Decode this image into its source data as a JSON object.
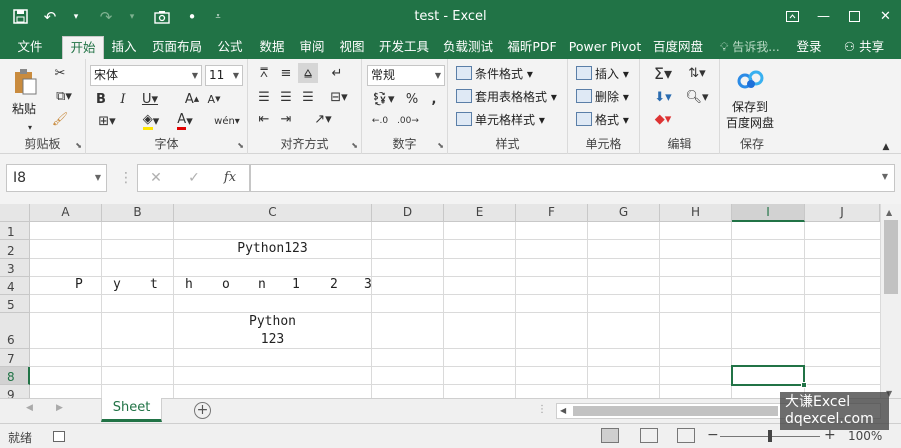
{
  "app": {
    "title": "test - Excel",
    "accent": "#217346"
  },
  "qat": {
    "icons": [
      "save-icon",
      "undo-icon",
      "redo-icon",
      "screenshot-icon",
      "touch-mode-icon",
      "customize-qat-icon"
    ]
  },
  "window_controls": [
    "ribbon-display-options-icon",
    "minimize-icon",
    "maximize-icon",
    "close-icon"
  ],
  "tabs": [
    "文件",
    "开始",
    "插入",
    "页面布局",
    "公式",
    "数据",
    "审阅",
    "视图",
    "开发工具",
    "负载测试",
    "福昕PDF",
    "Power Pivot",
    "百度网盘"
  ],
  "active_tab": "开始",
  "tell_me": "告诉我...",
  "login": "登录",
  "share": "共享",
  "ribbon": {
    "clipboard": {
      "label": "剪贴板",
      "paste": "粘贴"
    },
    "font": {
      "label": "字体",
      "name": "宋体",
      "size": "11"
    },
    "alignment": {
      "label": "对齐方式"
    },
    "number": {
      "label": "数字",
      "format": "常规"
    },
    "styles": {
      "label": "样式",
      "conditional": "条件格式",
      "table_format": "套用表格格式",
      "cell_styles": "单元格样式"
    },
    "cells": {
      "label": "单元格",
      "insert": "插入",
      "delete": "删除",
      "format": "格式"
    },
    "editing": {
      "label": "编辑"
    },
    "save": {
      "label": "保存",
      "button_line1": "保存到",
      "button_line2": "百度网盘"
    }
  },
  "formula_bar": {
    "name_box": "I8",
    "fx": "fx",
    "value": ""
  },
  "grid": {
    "columns": [
      "A",
      "B",
      "C",
      "D",
      "E",
      "F",
      "G",
      "H",
      "I",
      "J"
    ],
    "selected_column": "I",
    "rows": [
      "1",
      "2",
      "3",
      "4",
      "5",
      "6",
      "7",
      "8",
      "9"
    ],
    "selected_row": "8",
    "active_cell": "I8",
    "cells": {
      "C2": "Python123",
      "A4_distributed": [
        "P",
        "y",
        "t",
        "h",
        "o",
        "n",
        "1",
        "2",
        "3"
      ],
      "C6_line1": "Python",
      "C6_line2": "123"
    }
  },
  "sheets": [
    "Sheet"
  ],
  "active_sheet": "Sheet",
  "status": {
    "mode": "就绪",
    "zoom": "100%"
  },
  "watermark": {
    "line1": "大谦Excel",
    "line2": "dqexcel.com"
  }
}
